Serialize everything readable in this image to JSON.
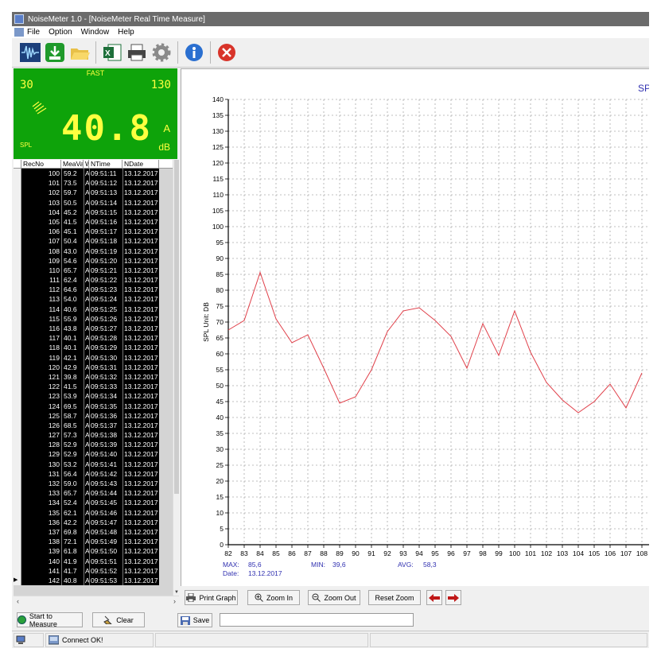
{
  "window": {
    "title": "NoiseMeter 1.0  - [NoiseMeter Real Time Measure]"
  },
  "menu": [
    "File",
    "Option",
    "Window",
    "Help"
  ],
  "toolbar": {
    "icons": [
      "waveform-icon",
      "export-pdf-icon",
      "open-folder-icon",
      "excel-icon",
      "printer-icon",
      "settings-gear-icon",
      "info-icon",
      "close-red-icon"
    ]
  },
  "meter": {
    "mode": "FAST",
    "range_min": "30",
    "range_max": "130",
    "value": "40.8",
    "weighting": "A",
    "unit": "dB",
    "label": "SPL",
    "bg_color": "#0ea30a",
    "digit_color": "#ffff40"
  },
  "table": {
    "headers": [
      "RecNo",
      "MeaVal",
      "W",
      "NTime",
      "NDate"
    ],
    "rows": [
      [
        "100",
        "59.2",
        "A",
        "09:51:11",
        "13.12.2017"
      ],
      [
        "101",
        "73.5",
        "A",
        "09:51:12",
        "13.12.2017"
      ],
      [
        "102",
        "59.7",
        "A",
        "09:51:13",
        "13.12.2017"
      ],
      [
        "103",
        "50.5",
        "A",
        "09:51:14",
        "13.12.2017"
      ],
      [
        "104",
        "45.2",
        "A",
        "09:51:15",
        "13.12.2017"
      ],
      [
        "105",
        "41.5",
        "A",
        "09:51:16",
        "13.12.2017"
      ],
      [
        "106",
        "45.1",
        "A",
        "09:51:17",
        "13.12.2017"
      ],
      [
        "107",
        "50.4",
        "A",
        "09:51:18",
        "13.12.2017"
      ],
      [
        "108",
        "43.0",
        "A",
        "09:51:19",
        "13.12.2017"
      ],
      [
        "109",
        "54.6",
        "A",
        "09:51:20",
        "13.12.2017"
      ],
      [
        "110",
        "65.7",
        "A",
        "09:51:21",
        "13.12.2017"
      ],
      [
        "111",
        "62.4",
        "A",
        "09:51:22",
        "13.12.2017"
      ],
      [
        "112",
        "64.6",
        "A",
        "09:51:23",
        "13.12.2017"
      ],
      [
        "113",
        "54.0",
        "A",
        "09:51:24",
        "13.12.2017"
      ],
      [
        "114",
        "40.6",
        "A",
        "09:51:25",
        "13.12.2017"
      ],
      [
        "115",
        "55.9",
        "A",
        "09:51:26",
        "13.12.2017"
      ],
      [
        "116",
        "43.8",
        "A",
        "09:51:27",
        "13.12.2017"
      ],
      [
        "117",
        "40.1",
        "A",
        "09:51:28",
        "13.12.2017"
      ],
      [
        "118",
        "40.1",
        "A",
        "09:51:29",
        "13.12.2017"
      ],
      [
        "119",
        "42.1",
        "A",
        "09:51:30",
        "13.12.2017"
      ],
      [
        "120",
        "42.9",
        "A",
        "09:51:31",
        "13.12.2017"
      ],
      [
        "121",
        "39.8",
        "A",
        "09:51:32",
        "13.12.2017"
      ],
      [
        "122",
        "41.5",
        "A",
        "09:51:33",
        "13.12.2017"
      ],
      [
        "123",
        "53.9",
        "A",
        "09:51:34",
        "13.12.2017"
      ],
      [
        "124",
        "69.5",
        "A",
        "09:51:35",
        "13.12.2017"
      ],
      [
        "125",
        "58.7",
        "A",
        "09:51:36",
        "13.12.2017"
      ],
      [
        "126",
        "68.5",
        "A",
        "09:51:37",
        "13.12.2017"
      ],
      [
        "127",
        "57.3",
        "A",
        "09:51:38",
        "13.12.2017"
      ],
      [
        "128",
        "52.9",
        "A",
        "09:51:39",
        "13.12.2017"
      ],
      [
        "129",
        "52.9",
        "A",
        "09:51:40",
        "13.12.2017"
      ],
      [
        "130",
        "53.2",
        "A",
        "09:51:41",
        "13.12.2017"
      ],
      [
        "131",
        "56.4",
        "A",
        "09:51:42",
        "13.12.2017"
      ],
      [
        "132",
        "59.0",
        "A",
        "09:51:43",
        "13.12.2017"
      ],
      [
        "133",
        "65.7",
        "A",
        "09:51:44",
        "13.12.2017"
      ],
      [
        "134",
        "52.4",
        "A",
        "09:51:45",
        "13.12.2017"
      ],
      [
        "135",
        "62.1",
        "A",
        "09:51:46",
        "13.12.2017"
      ],
      [
        "136",
        "42.2",
        "A",
        "09:51:47",
        "13.12.2017"
      ],
      [
        "137",
        "69.8",
        "A",
        "09:51:48",
        "13.12.2017"
      ],
      [
        "138",
        "72.1",
        "A",
        "09:51:49",
        "13.12.2017"
      ],
      [
        "139",
        "61.8",
        "A",
        "09:51:50",
        "13.12.2017"
      ],
      [
        "140",
        "41.9",
        "A",
        "09:51:51",
        "13.12.2017"
      ],
      [
        "141",
        "41.7",
        "A",
        "09:51:52",
        "13.12.2017"
      ],
      [
        "142",
        "40.8",
        "A",
        "09:51:53",
        "13.12.2017"
      ]
    ],
    "current_row_marker": "▶"
  },
  "chart_data": {
    "type": "line",
    "title": "SP",
    "xlabel": "",
    "ylabel": "SPL  Unit: DB",
    "ylim": [
      0,
      140
    ],
    "ytick_step": 5,
    "xlim": [
      82,
      108
    ],
    "x": [
      82,
      83,
      84,
      85,
      86,
      87,
      88,
      89,
      90,
      91,
      92,
      93,
      94,
      95,
      96,
      97,
      98,
      99,
      100,
      101,
      102,
      103,
      104,
      105,
      106,
      107,
      108
    ],
    "values": [
      67.5,
      70.5,
      85.6,
      71,
      63.5,
      66,
      55.5,
      44.5,
      46.5,
      55,
      67,
      73.5,
      74.5,
      70.5,
      65.5,
      55.5,
      69.5,
      59.5,
      73.5,
      60.5,
      51,
      45.5,
      41.5,
      45,
      50.5,
      43,
      54
    ],
    "line_color": "#e0404a",
    "grid": true,
    "stats": {
      "max_label": "MAX:",
      "max": "85,6",
      "min_label": "MIN:",
      "min": "39,6",
      "avg_label": "AVG:",
      "avg": "58,3",
      "date_label": "Date:",
      "date": "13.12.2017"
    }
  },
  "chart_buttons": {
    "print": "Print Graph",
    "zoom_in": "Zoom In",
    "zoom_out": "Zoom Out",
    "reset": "Reset Zoom"
  },
  "bottom": {
    "start": "Start to Measure",
    "clear": "Clear",
    "save": "Save",
    "save_path": ""
  },
  "status": {
    "message": "Connect OK!"
  }
}
